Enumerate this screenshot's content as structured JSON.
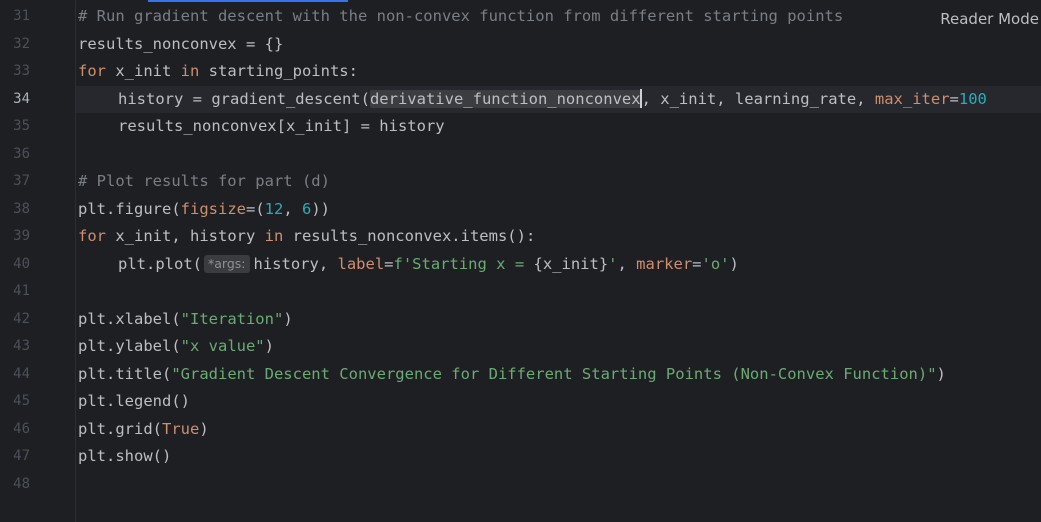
{
  "editor": {
    "reader_mode_label": "Reader Mode",
    "current_line": "34",
    "colors": {
      "background": "#1e1f22",
      "keyword": "#cf8e6d",
      "string": "#6aab73",
      "number": "#2aacb8",
      "comment": "#7a7e85",
      "text": "#bcbec4"
    }
  },
  "lines": [
    {
      "number": "31",
      "comment": "# Run gradient descent with the non-convex function from different starting points"
    },
    {
      "number": "32",
      "text": "results_nonconvex = {}"
    },
    {
      "number": "33",
      "kw1": "for",
      "t1": " x_init ",
      "kw2": "in",
      "t2": " starting_points:"
    },
    {
      "number": "34",
      "t1": "history = gradient_descent(",
      "match": "derivative_function_nonconvex",
      "t2": ", x_init, learning_rate, ",
      "param": "max_iter",
      "t3": "=",
      "num": "100"
    },
    {
      "number": "35",
      "text": "results_nonconvex[x_init] = history"
    },
    {
      "number": "36"
    },
    {
      "number": "37",
      "comment": "# Plot results for part (d)"
    },
    {
      "number": "38",
      "t1": "plt.figure(",
      "param": "figsize",
      "t2": "=(",
      "num1": "12",
      "t3": ", ",
      "num2": "6",
      "t4": "))"
    },
    {
      "number": "39",
      "kw1": "for",
      "t1": " x_init, history ",
      "kw2": "in",
      "t2": " results_nonconvex.items():"
    },
    {
      "number": "40",
      "t1": "plt.plot(",
      "hint": "*args:",
      "t2": "history, ",
      "param1": "label",
      "t3": "=",
      "str1": "f'Starting x = ",
      "t4": "{x_init}",
      "str2": "'",
      "t5": ", ",
      "param2": "marker",
      "t6": "=",
      "str3": "'o'",
      "t7": ")"
    },
    {
      "number": "41"
    },
    {
      "number": "42",
      "t1": "plt.xlabel(",
      "str": "\"Iteration\"",
      "t2": ")"
    },
    {
      "number": "43",
      "t1": "plt.ylabel(",
      "str": "\"x value\"",
      "t2": ")"
    },
    {
      "number": "44",
      "t1": "plt.title(",
      "str": "\"Gradient Descent Convergence for Different Starting Points (Non-Convex Function)\"",
      "t2": ")"
    },
    {
      "number": "45",
      "text": "plt.legend()"
    },
    {
      "number": "46",
      "t1": "plt.grid(",
      "kw": "True",
      "t2": ")"
    },
    {
      "number": "47",
      "text": "plt.show()"
    },
    {
      "number": "48"
    }
  ]
}
